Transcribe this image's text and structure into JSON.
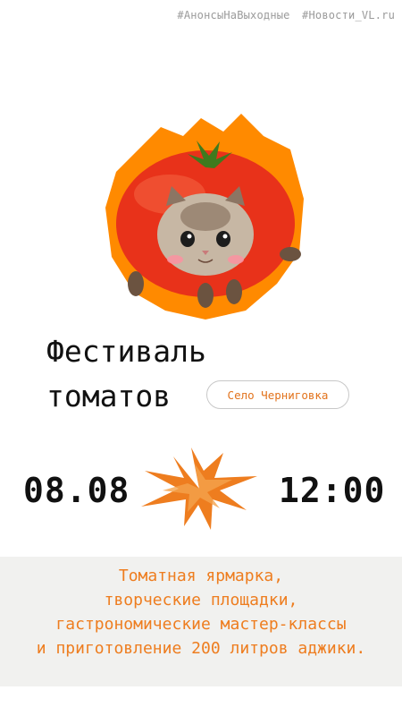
{
  "hashtags": [
    "#АнонсыНаВыходные",
    "#Новости_VL.ru"
  ],
  "title": {
    "line1": "Фестиваль",
    "line2": "томатов"
  },
  "location": "Село Черниговка",
  "date": "08.08",
  "time": "12:00",
  "description": [
    "Томатная ярмарка,",
    "творческие площадки,",
    "гастрономические мастер-классы",
    "и приготовление 200 литров аджики."
  ],
  "colors": {
    "accent": "#ee7d1f",
    "tomato": "#e8321a",
    "panel": "#f1f1ef"
  },
  "images": {
    "hero": "tomato-cat-illustration",
    "divider": "orange-star-splash-icon"
  }
}
